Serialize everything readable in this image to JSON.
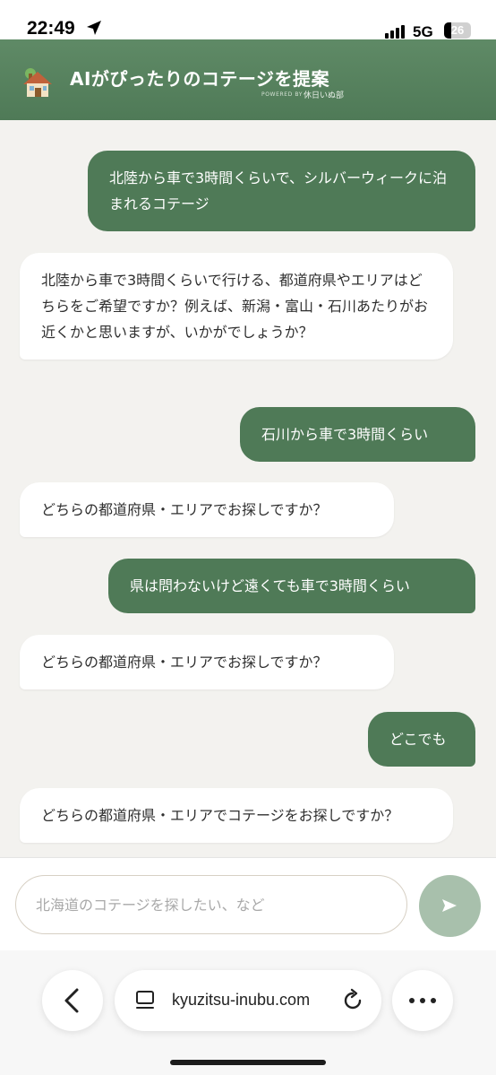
{
  "status_bar": {
    "time": "22:49",
    "network": "5G",
    "battery": "26"
  },
  "header": {
    "title": "AIがぴったりのコテージを提案",
    "powered_by": "POWERED BY",
    "brand": "休日いぬ部"
  },
  "messages": [
    {
      "role": "user",
      "text": "北陸から車で3時間くらいで、シルバーウィークに泊まれるコテージ"
    },
    {
      "role": "bot",
      "text": "北陸から車で3時間くらいで行ける、都道府県やエリアはどちらをご希望ですか？例えば、新潟・富山・石川あたりがお近くかと思いますが、いかがでしょうか？"
    },
    {
      "role": "user",
      "text": "石川から車で3時間くらい"
    },
    {
      "role": "bot",
      "text": "どちらの都道府県・エリアでお探しですか？"
    },
    {
      "role": "user",
      "text": "県は問わないけど遠くても車で3時間くらい"
    },
    {
      "role": "bot",
      "text": "どちらの都道府県・エリアでお探しですか？"
    },
    {
      "role": "user",
      "text": "どこでも"
    },
    {
      "role": "bot",
      "text": "どちらの都道府県・エリアでコテージをお探しですか？"
    }
  ],
  "input": {
    "placeholder": "北海道のコテージを探したい、など",
    "value": ""
  },
  "browser": {
    "url": "kyuzitsu-inubu.com"
  },
  "colors": {
    "accent": "#4f7a57",
    "send_button": "#a8c0ac",
    "background": "#f3f2ef"
  },
  "icons": [
    "location-arrow-icon",
    "signal-icon",
    "battery-icon",
    "house-icon",
    "send-icon",
    "back-icon",
    "tabs-icon",
    "reload-icon",
    "more-icon"
  ]
}
